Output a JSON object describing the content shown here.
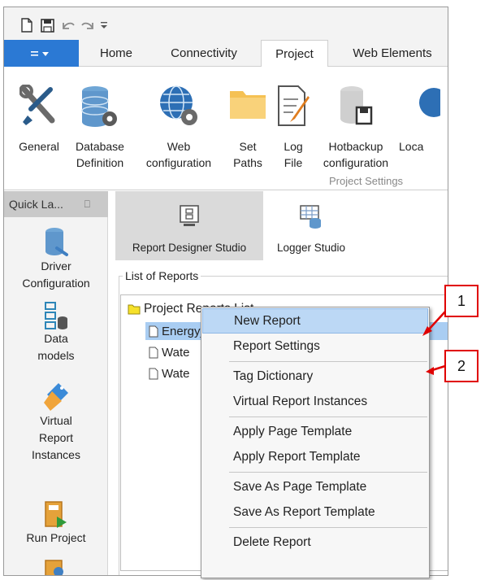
{
  "qat": {
    "icons": [
      "new-document-icon",
      "save-icon",
      "undo-icon",
      "redo-icon",
      "customize-icon"
    ]
  },
  "tabs": [
    {
      "label": "Home"
    },
    {
      "label": "Connectivity"
    },
    {
      "label": "Project",
      "active": true
    },
    {
      "label": "Web Elements"
    }
  ],
  "ribbon": {
    "buttons": [
      {
        "label": "General",
        "icon": "tools-icon"
      },
      {
        "label": "Database\nDefinition",
        "icon": "database-gear-icon"
      },
      {
        "label": "Web\nconfiguration",
        "icon": "globe-gear-icon"
      },
      {
        "label": "Set\nPaths",
        "icon": "folder-icon"
      },
      {
        "label": "Log\nFile",
        "icon": "log-file-icon"
      },
      {
        "label": "Hotbackup\nconfiguration",
        "icon": "hotbackup-icon"
      },
      {
        "label": "Loca",
        "icon": "globe-icon"
      }
    ],
    "group_label": "Project Settings"
  },
  "sidebar": {
    "header": "Quick La...",
    "items": [
      {
        "label": "Driver\nConfiguration",
        "icon": "driver-config-icon"
      },
      {
        "label": "Data\nmodels",
        "icon": "data-models-icon"
      },
      {
        "label": "Virtual\nReport\nInstances",
        "icon": "virtual-instances-icon"
      },
      {
        "label": "Run Project",
        "icon": "run-project-icon"
      }
    ]
  },
  "studio": {
    "buttons": [
      {
        "label": "Report Designer Studio",
        "active": true
      },
      {
        "label": "Logger Studio"
      }
    ]
  },
  "reports": {
    "legend": "List of Reports",
    "root": "Project Reports List",
    "items": [
      "Energy_Report",
      "Wate",
      "Wate"
    ]
  },
  "context_menu": {
    "items": [
      "New Report",
      "Report Settings",
      "Tag Dictionary",
      "Virtual Report Instances",
      "Apply Page Template",
      "Apply Report Template",
      "Save As Page Template",
      "Save As Report Template",
      "Delete Report"
    ]
  },
  "callouts": [
    "1",
    "2"
  ],
  "colors": {
    "accent": "#2b79d4",
    "selection": "#bcd8f5",
    "callout": "#e00000"
  }
}
